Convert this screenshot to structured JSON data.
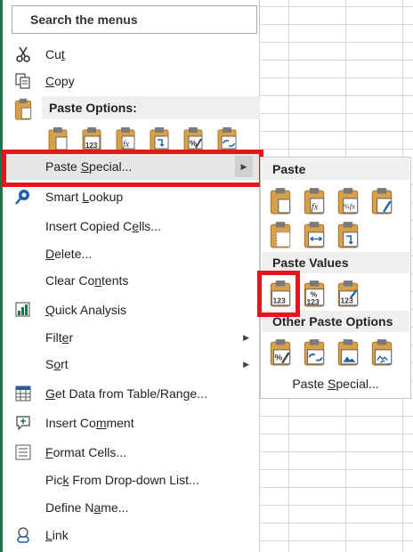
{
  "search": {
    "label": "Search the menus"
  },
  "menu": {
    "cut": {
      "pre": "Cu",
      "acc": "t",
      "post": ""
    },
    "copy": {
      "pre": "",
      "acc": "C",
      "post": "opy"
    },
    "paste_options": "Paste Options:",
    "paste_special": {
      "pre": "Paste ",
      "acc": "S",
      "post": "pecial..."
    },
    "smart_lookup": {
      "pre": "Smart ",
      "acc": "L",
      "post": "ookup"
    },
    "insert_copied_cells": {
      "pre": "Insert Copied C",
      "acc": "e",
      "post": "lls..."
    },
    "delete": {
      "pre": "",
      "acc": "D",
      "post": "elete..."
    },
    "clear_contents": {
      "pre": "Clear Co",
      "acc": "n",
      "post": "tents"
    },
    "quick_analysis": {
      "pre": "",
      "acc": "Q",
      "post": "uick Analysis"
    },
    "filter": {
      "pre": "Filt",
      "acc": "e",
      "post": "r"
    },
    "sort": {
      "pre": "S",
      "acc": "o",
      "post": "rt"
    },
    "get_data": {
      "pre": "",
      "acc": "G",
      "post": "et Data from Table/Range..."
    },
    "insert_comment": {
      "pre": "Insert Co",
      "acc": "m",
      "post": "ment"
    },
    "format_cells": {
      "pre": "",
      "acc": "F",
      "post": "ormat Cells..."
    },
    "pick_dropdown": {
      "pre": "Pic",
      "acc": "k",
      "post": " From Drop-down List..."
    },
    "define_name": {
      "pre": "Define N",
      "acc": "a",
      "post": "me..."
    },
    "link": {
      "pre": "",
      "acc": "L",
      "post": "ink"
    }
  },
  "submenu": {
    "paste": "Paste",
    "paste_values": "Paste Values",
    "other_paste_options": "Other Paste Options",
    "paste_special_link": {
      "pre": "Paste ",
      "acc": "S",
      "post": "pecial..."
    }
  },
  "icon_labels": {
    "v123": "123",
    "pct": "%",
    "fx": "fx",
    "pct_fx": "%fx"
  },
  "colors": {
    "highlight_box": "#e8141b",
    "clipboard": "#d9a04a",
    "icon_blue": "#1f5fa8",
    "section_bg": "#efefef"
  }
}
